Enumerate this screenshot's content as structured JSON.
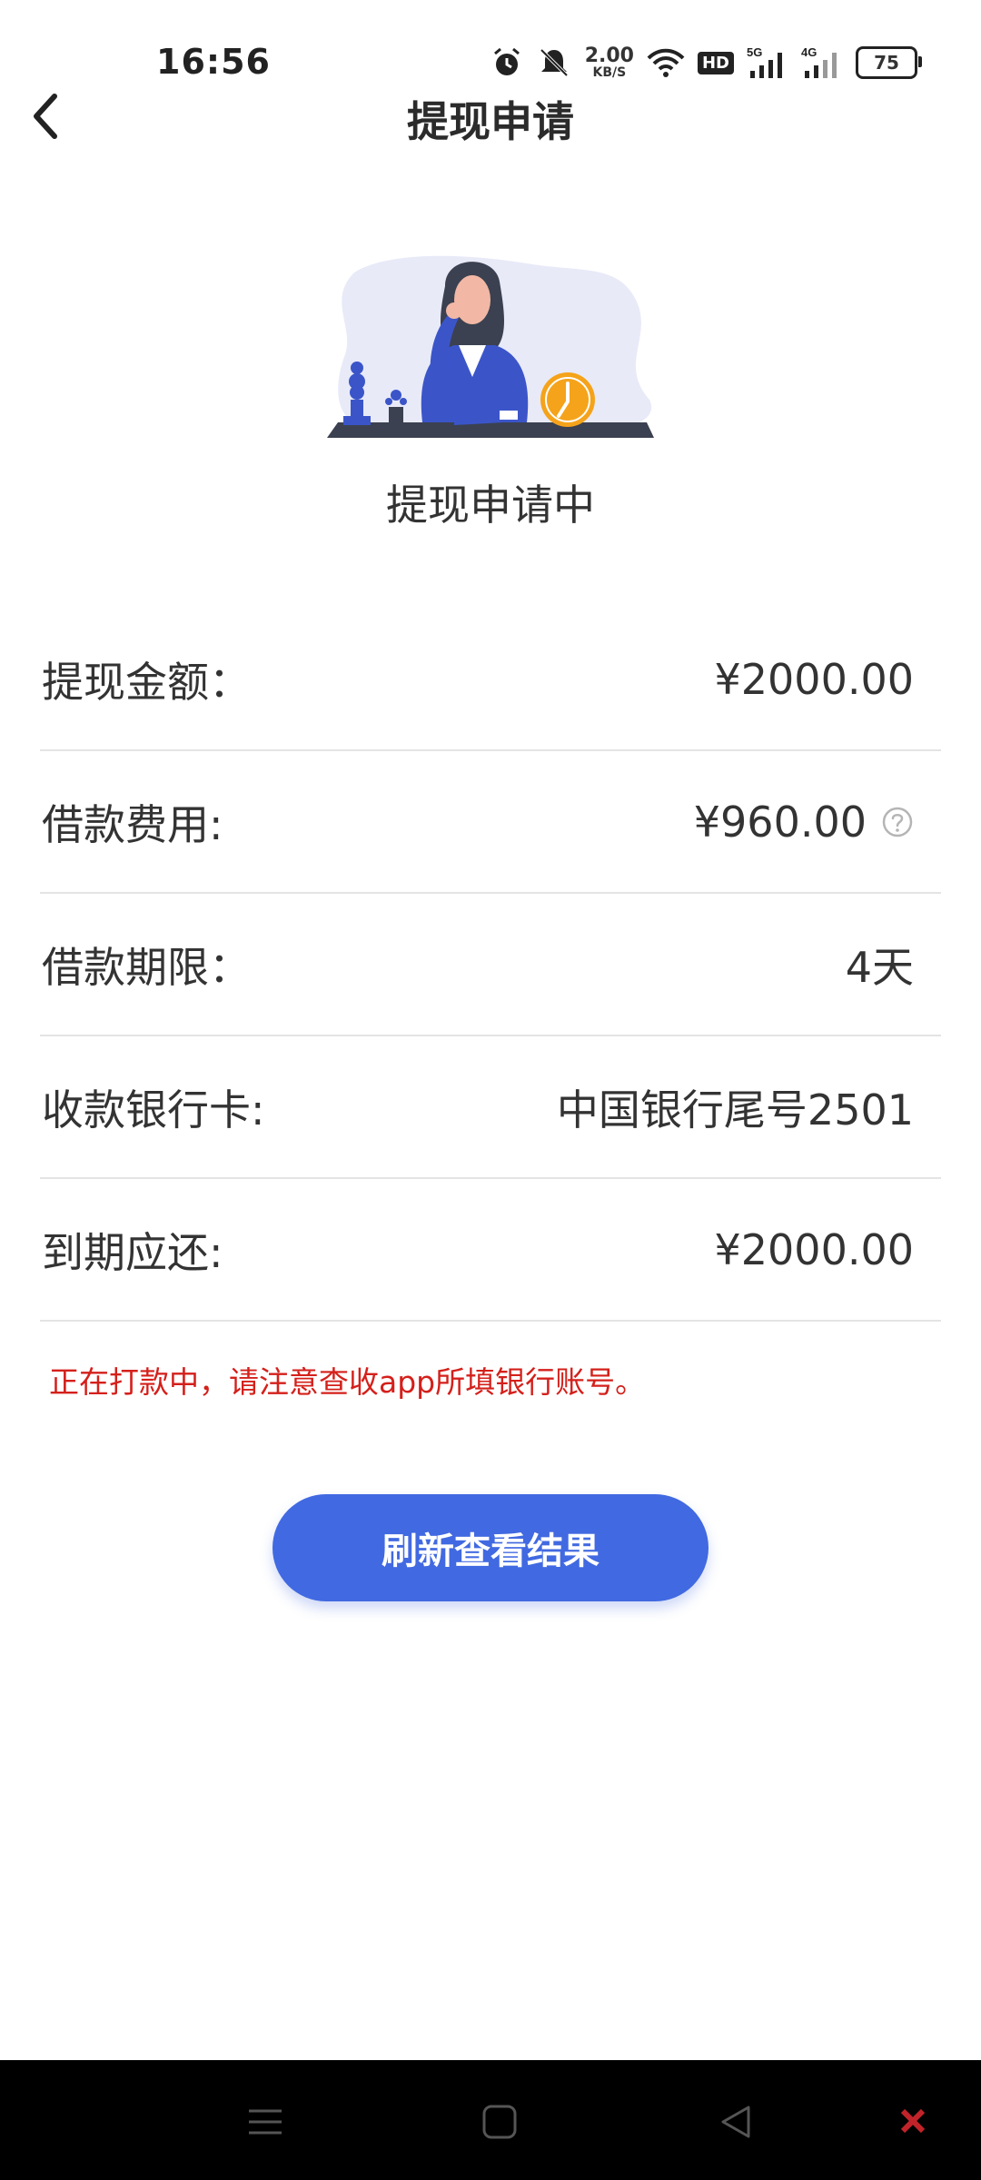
{
  "status_bar": {
    "time": "16:56",
    "net_speed_value": "2.00",
    "net_speed_unit": "KB/S",
    "hd_badge": "HD",
    "signal_5g": "5G",
    "signal_4g": "4G",
    "battery": "75",
    "icons": [
      "alarm-icon",
      "mute-icon",
      "wifi-icon",
      "signal-icon",
      "battery-icon"
    ]
  },
  "header": {
    "title": "提现申请",
    "back_icon": "chevron-left-icon"
  },
  "illustration": {
    "caption": "提现申请中"
  },
  "details": [
    {
      "label": "提现金额：",
      "value": "¥2000.00"
    },
    {
      "label": "借款费用:",
      "value": "¥960.00"
    },
    {
      "label": "借款期限：",
      "value": "4天"
    },
    {
      "label": "收款银行卡:",
      "value": "中国银行尾号2501"
    },
    {
      "label": "到期应还:",
      "value": "¥2000.00"
    }
  ],
  "notice": "正在打款中，请注意查收app所填银行账号。",
  "refresh_button": "刷新查看结果",
  "colors": {
    "accent": "#4169e1",
    "notice": "#d4201b",
    "clock": "#f5a31a",
    "divider": "#e4e4e4"
  },
  "nav_bar": {
    "icons": [
      "menu-icon",
      "home-square-icon",
      "back-triangle-icon"
    ]
  }
}
